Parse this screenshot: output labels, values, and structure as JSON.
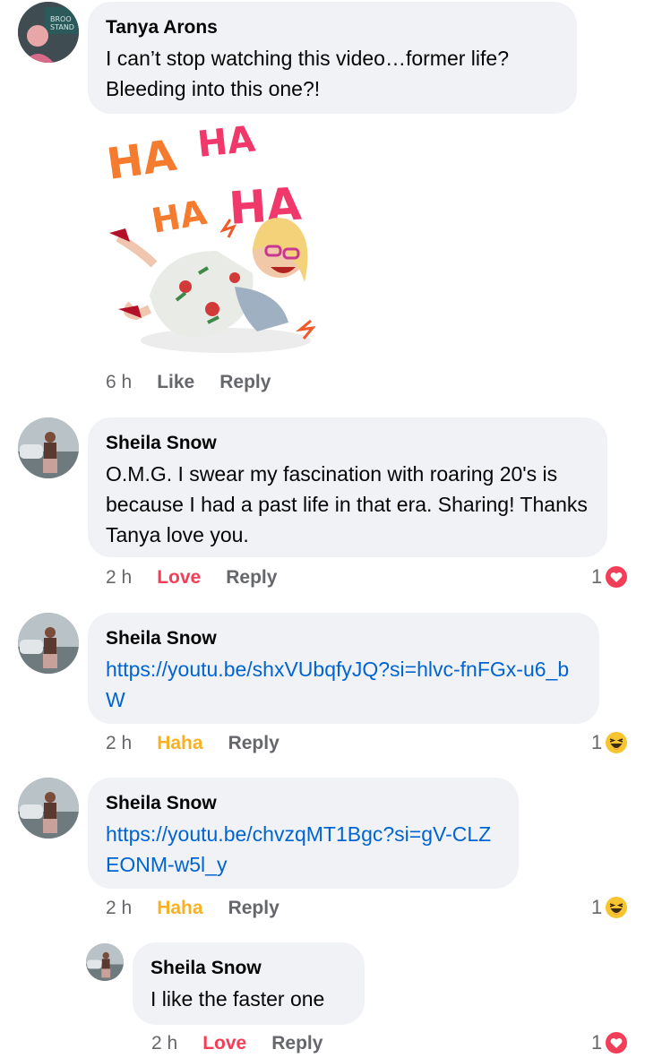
{
  "comments": [
    {
      "author": "Tanya Arons",
      "text": "I can’t stop watching this video…former life? Bleeding into this one?!",
      "time": "6 h",
      "action": "Like",
      "reply": "Reply",
      "sticker": {
        "words": [
          "HA",
          "HA",
          "HA",
          "HA"
        ]
      }
    },
    {
      "author": "Sheila Snow",
      "text": "O.M.G. I swear my fascination with roaring 20's is because I had a past life in that era. Sharing! Thanks Tanya love you.",
      "time": "2 h",
      "action": "Love",
      "reply": "Reply",
      "reaction_count": "1",
      "reaction": "love-icon"
    },
    {
      "author": "Sheila Snow",
      "text": "https://youtu.be/shxVUbqfyJQ?si=hlvc-fnFGx-u6_bW",
      "time": "2 h",
      "action": "Haha",
      "reply": "Reply",
      "reaction_count": "1",
      "reaction": "haha-icon"
    },
    {
      "author": "Sheila Snow",
      "text": "https://youtu.be/chvzqMT1Bgc?si=gV-CLZEONM-w5l_y",
      "time": "2 h",
      "action": "Haha",
      "reply": "Reply",
      "reaction_count": "1",
      "reaction": "haha-icon"
    },
    {
      "author": "Sheila Snow",
      "text": "I like the faster one",
      "time": "2 h",
      "action": "Love",
      "reply": "Reply",
      "reaction_count": "1",
      "reaction": "love-icon"
    }
  ],
  "colors": {
    "bubble": "#f0f2f5",
    "link": "#0064d1",
    "love": "#f33e58",
    "haha": "#f7b125",
    "meta": "#65676b"
  }
}
